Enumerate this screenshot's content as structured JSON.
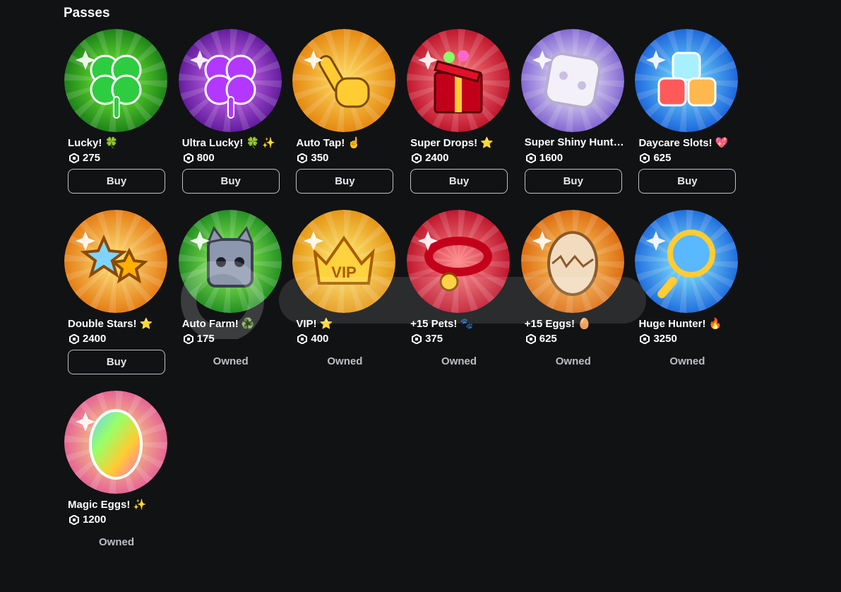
{
  "section": {
    "title": "Passes"
  },
  "currency_icon": "robux-icon",
  "passes": [
    {
      "name": "Lucky! 🍀",
      "price": "275",
      "action": "Buy",
      "owned": false,
      "icon": "four-leaf-clover-icon",
      "bg": [
        "#7dff3a",
        "#0b6b12"
      ],
      "accent": "#2ecc40"
    },
    {
      "name": "Ultra Lucky! 🍀 ✨",
      "price": "800",
      "action": "Buy",
      "owned": false,
      "icon": "purple-clover-icon",
      "bg": [
        "#e07bff",
        "#4a0a8a"
      ],
      "accent": "#b238ff"
    },
    {
      "name": "Auto Tap! ☝️",
      "price": "350",
      "action": "Buy",
      "owned": false,
      "icon": "tapping-hand-icon",
      "bg": [
        "#ffe066",
        "#e07800"
      ],
      "accent": "#f5b300"
    },
    {
      "name": "Super Drops! ⭐",
      "price": "2400",
      "action": "Buy",
      "owned": false,
      "icon": "gift-box-icon",
      "bg": [
        "#ff8a8a",
        "#b3001b"
      ],
      "accent": "#d6102a"
    },
    {
      "name": "Super Shiny Hunter!",
      "price": "1600",
      "action": "Buy",
      "owned": false,
      "icon": "shiny-dice-icon",
      "bg": [
        "#ffffff",
        "#6a4bc8"
      ],
      "accent": "#d9d3ea"
    },
    {
      "name": "Daycare Slots! 💖",
      "price": "625",
      "action": "Buy",
      "owned": false,
      "icon": "colored-cubes-icon",
      "bg": [
        "#7fe7ff",
        "#0a4fd6"
      ],
      "accent": "#2fa6ff"
    },
    {
      "name": "Double Stars! ⭐",
      "price": "2400",
      "action": "Buy",
      "owned": false,
      "icon": "double-stars-icon",
      "bg": [
        "#ffe680",
        "#e06a00"
      ],
      "accent": "#ffb000"
    },
    {
      "name": "Auto Farm! ♻️",
      "price": "175",
      "action": "Owned",
      "owned": true,
      "icon": "cat-block-icon",
      "bg": [
        "#9dff5a",
        "#0d7a1a"
      ],
      "accent": "#3fd24a"
    },
    {
      "name": "VIP! ⭐",
      "price": "400",
      "action": "Owned",
      "owned": true,
      "icon": "vip-crown-icon",
      "bg": [
        "#fff07a",
        "#e08500"
      ],
      "accent": "#ffc400"
    },
    {
      "name": "+15 Pets! 🐾",
      "price": "375",
      "action": "Owned",
      "owned": true,
      "icon": "pet-collar-icon",
      "bg": [
        "#ff8c8c",
        "#b3001b"
      ],
      "accent": "#e0182e"
    },
    {
      "name": "+15 Eggs! 🥚",
      "price": "625",
      "action": "Owned",
      "owned": true,
      "icon": "cracked-egg-icon",
      "bg": [
        "#ffd36b",
        "#d65a00"
      ],
      "accent": "#f08a10"
    },
    {
      "name": "Huge Hunter! 🔥",
      "price": "3250",
      "action": "Owned",
      "owned": true,
      "icon": "magnifying-glass-icon",
      "bg": [
        "#8ff0ff",
        "#0a55d8"
      ],
      "accent": "#1fa0ff"
    },
    {
      "name": "Magic Eggs! ✨",
      "price": "1200",
      "action": "Owned",
      "owned": true,
      "icon": "rainbow-egg-icon",
      "bg": [
        "#fff07a",
        "#e04a9a"
      ],
      "accent": "#ff66cc"
    }
  ]
}
